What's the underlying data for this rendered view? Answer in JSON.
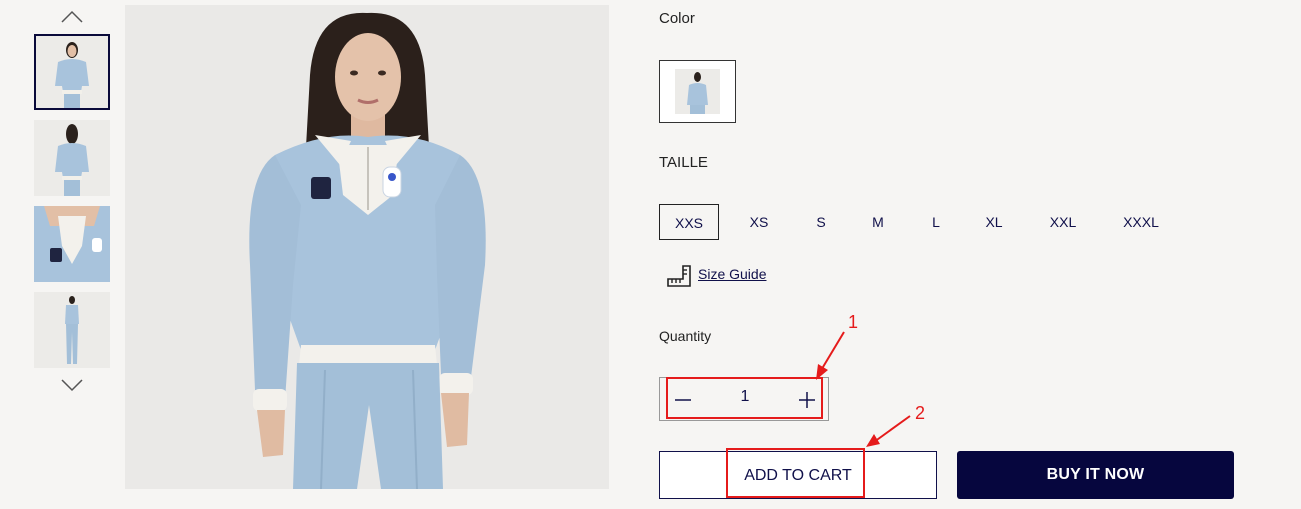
{
  "gallery": {
    "up_icon": "chevron-up-icon",
    "down_icon": "chevron-down-icon",
    "thumbnails": [
      "thumbnail-front",
      "thumbnail-back",
      "thumbnail-collar-detail",
      "thumbnail-full-body"
    ]
  },
  "product": {
    "color_label": "Color",
    "size_label": "TAILLE",
    "sizes": [
      "XXS",
      "XS",
      "S",
      "M",
      "L",
      "XL",
      "XXL",
      "XXXL"
    ],
    "selected_size": "XXS",
    "size_guide_label": "Size Guide",
    "quantity_label": "Quantity",
    "quantity_value": "1",
    "add_to_cart_label": "ADD TO CART",
    "buy_now_label": "BUY IT NOW"
  },
  "annotations": {
    "one": "1",
    "two": "2",
    "color": "#e51b1b"
  },
  "colors": {
    "navy": "#06063e",
    "jacket": "#a8c3dc",
    "background": "#f6f5f3"
  }
}
